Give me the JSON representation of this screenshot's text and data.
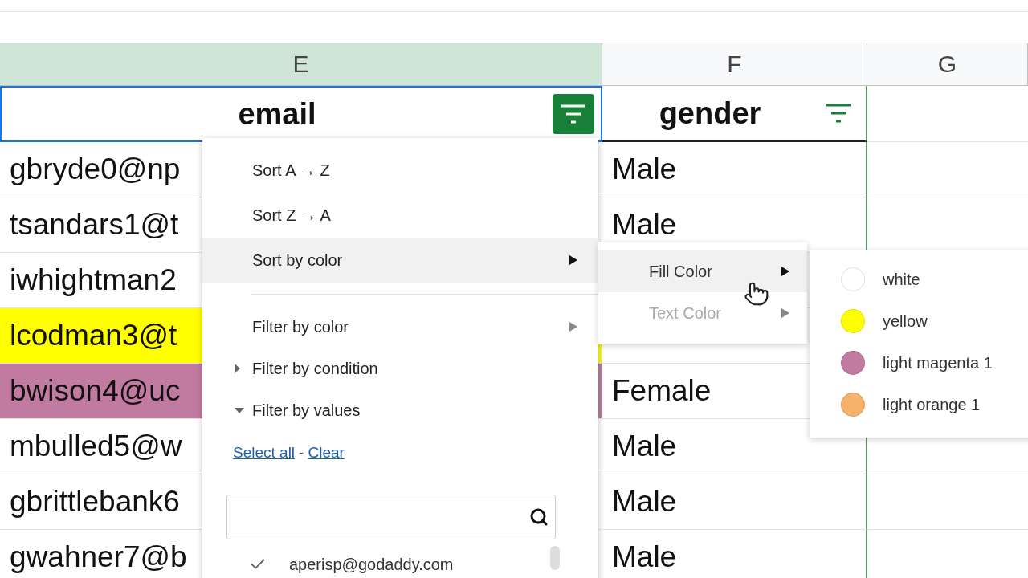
{
  "columns": [
    {
      "letter": "E",
      "selected": true
    },
    {
      "letter": "F",
      "selected": false
    },
    {
      "letter": "G",
      "selected": false
    }
  ],
  "header_cells": [
    {
      "label": "email",
      "filter_active": true
    },
    {
      "label": "gender",
      "filter_active": false
    }
  ],
  "rows": [
    {
      "email": "gbryde0@np",
      "gender": "Male"
    },
    {
      "email": "tsandars1@t",
      "gender": "Male"
    },
    {
      "email": "iwhightman2"
    },
    {
      "email": "lcodman3@t",
      "color": "#ffff00"
    },
    {
      "email": "bwison4@uc",
      "gender": "Female",
      "color": "#c27ba0"
    },
    {
      "email": "mbulled5@w",
      "gender": "Male"
    },
    {
      "email": "gbrittlebank6",
      "gender": "Male"
    },
    {
      "email": "gwahner7@b",
      "gender": "Male"
    }
  ],
  "filter_menu": {
    "items": [
      {
        "kind": "action",
        "label": "Sort A → Z",
        "highlighted": false
      },
      {
        "kind": "action",
        "label": "Sort Z → A",
        "highlighted": false
      },
      {
        "kind": "submenu",
        "label": "Sort by color",
        "highlighted": true
      },
      {
        "kind": "divider"
      },
      {
        "kind": "submenu",
        "label": "Filter by color",
        "highlighted": false
      },
      {
        "kind": "section",
        "label": "Filter by condition",
        "expanded": false
      },
      {
        "kind": "section",
        "label": "Filter by values",
        "expanded": true
      }
    ],
    "links": [
      "Select all",
      "Clear"
    ],
    "link_separator": "-",
    "values": [
      {
        "label": "aperisp@godaddy.com",
        "checked": true
      }
    ]
  },
  "sort_color_menu": {
    "items": [
      {
        "label": "Fill Color",
        "highlighted": true,
        "disabled": false
      },
      {
        "label": "Text Color",
        "highlighted": false,
        "disabled": true
      }
    ]
  },
  "fill_colors": [
    {
      "label": "white",
      "color": "#ffffff"
    },
    {
      "label": "yellow",
      "color": "#ffff00"
    },
    {
      "label": "light magenta 1",
      "color": "#c27ba0"
    },
    {
      "label": "light orange 1",
      "color": "#f6b26b"
    }
  ]
}
